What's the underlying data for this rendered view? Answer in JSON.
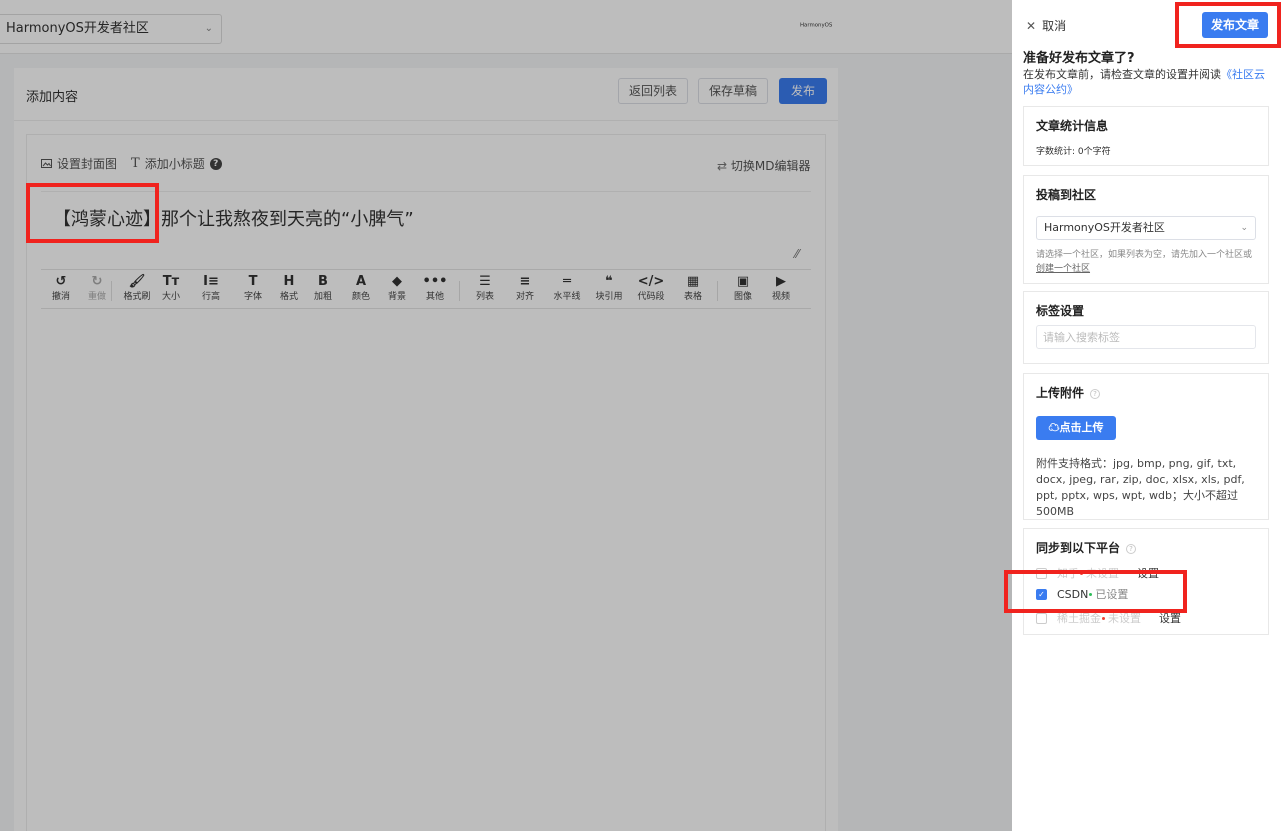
{
  "topbar": {
    "site": "HarmonyOS开发者社区",
    "logo_text": "HarmonyOS"
  },
  "content": {
    "title": "添加内容",
    "back_label": "返回列表",
    "draft_label": "保存草稿",
    "publish_label": "发布"
  },
  "editor": {
    "cover_label": "设置封面图",
    "subtitle_label": "添加小标题",
    "switch_md_label": "切换MD编辑器",
    "article_title": "【鸿蒙心迹】那个让我熬夜到天亮的“小脾气”",
    "toolbar": [
      {
        "icon": "↺",
        "label": "撤消",
        "name": "undo"
      },
      {
        "icon": "↻",
        "label": "重做",
        "name": "redo"
      },
      {
        "icon": "🖌",
        "label": "格式刷",
        "name": "format-painter"
      },
      {
        "icon": "Tт",
        "label": "大小",
        "name": "font-size"
      },
      {
        "icon": "I≡",
        "label": "行高",
        "name": "line-height"
      },
      {
        "icon": "T",
        "label": "字体",
        "name": "font-family"
      },
      {
        "icon": "H",
        "label": "格式",
        "name": "heading"
      },
      {
        "icon": "B",
        "label": "加粗",
        "name": "bold"
      },
      {
        "icon": "A",
        "label": "颜色",
        "name": "font-color"
      },
      {
        "icon": "◆",
        "label": "背景",
        "name": "background"
      },
      {
        "icon": "•••",
        "label": "其他",
        "name": "more"
      },
      {
        "icon": "☰",
        "label": "列表",
        "name": "list"
      },
      {
        "icon": "≡",
        "label": "对齐",
        "name": "align"
      },
      {
        "icon": "═",
        "label": "水平线",
        "name": "horizontal-rule"
      },
      {
        "icon": "❝",
        "label": "块引用",
        "name": "blockquote"
      },
      {
        "icon": "</>",
        "label": "代码段",
        "name": "code"
      },
      {
        "icon": "▦",
        "label": "表格",
        "name": "table"
      },
      {
        "icon": "▣",
        "label": "图像",
        "name": "image"
      },
      {
        "icon": "▶",
        "label": "视频",
        "name": "video"
      }
    ]
  },
  "drawer": {
    "cancel_label": "取消",
    "publish_label": "发布文章",
    "ready_title": "准备好发布文章了?",
    "ready_desc_prefix": "在发布文章前，请检查文章的设置并阅读",
    "ready_desc_link": "《社区云内容公约》",
    "stats_title": "文章统计信息",
    "word_count": "字数统计: 0个字符",
    "community_title": "投稿到社区",
    "community_value": "HarmonyOS开发者社区",
    "community_hint_prefix": "请选择一个社区，如果列表为空，请先加入一个社区或",
    "community_hint_link": "创建一个社区",
    "tags_title": "标签设置",
    "tags_placeholder": "请输入搜索标签",
    "upload_title": "上传附件",
    "upload_button": "点击上传",
    "upload_formats": "附件支持格式：jpg, bmp, png, gif, txt, docx, jpeg, rar, zip, doc, xlsx, xls, pdf, ppt, pptx, wps, wpt, wdb；大小不超过500MB",
    "sync_title": "同步到以下平台",
    "sync": [
      {
        "name": "知乎",
        "status": "未设置",
        "set": "设置",
        "checked": false
      },
      {
        "name": "CSDN",
        "status": "已设置",
        "set": "",
        "checked": true
      },
      {
        "name": "稀土掘金",
        "status": "未设置",
        "set": "设置",
        "checked": false
      }
    ]
  },
  "colors": {
    "accent": "#3a7cf0",
    "highlight": "#f0231e",
    "dot_green": "#2ebd59",
    "dot_red": "#f04134"
  }
}
